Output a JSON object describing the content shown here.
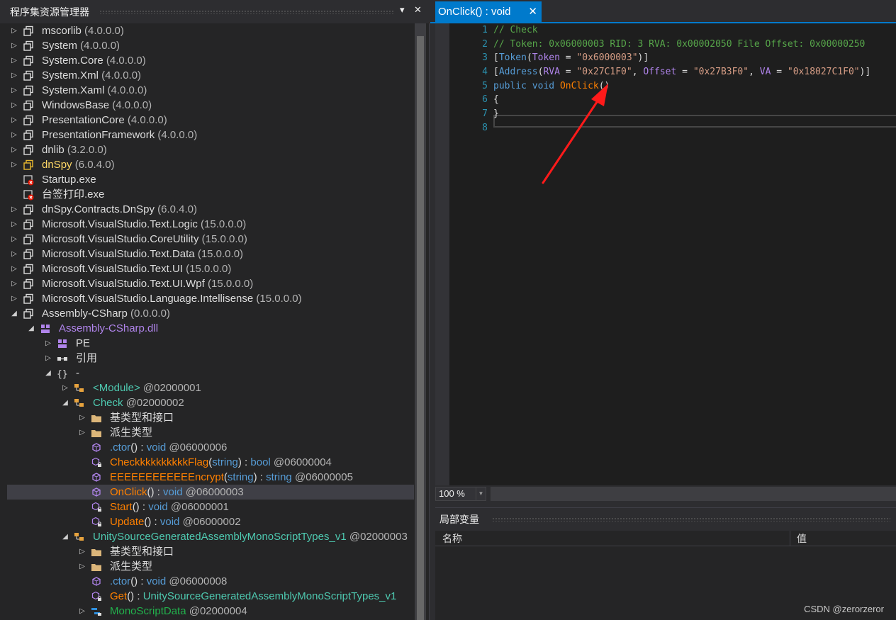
{
  "left_panel": {
    "title": "程序集资源管理器",
    "menu_glyph": "▾",
    "close_glyph": "✕",
    "tree": [
      {
        "indent": 0,
        "exp": "right",
        "icon": "assembly",
        "parts": [
          {
            "t": "mscorlib",
            "c": "white"
          },
          {
            "t": " (4.0.0.0)",
            "c": "gray"
          }
        ]
      },
      {
        "indent": 0,
        "exp": "right",
        "icon": "assembly",
        "parts": [
          {
            "t": "System",
            "c": "white"
          },
          {
            "t": " (4.0.0.0)",
            "c": "gray"
          }
        ]
      },
      {
        "indent": 0,
        "exp": "right",
        "icon": "assembly",
        "parts": [
          {
            "t": "System.Core",
            "c": "white"
          },
          {
            "t": " (4.0.0.0)",
            "c": "gray"
          }
        ]
      },
      {
        "indent": 0,
        "exp": "right",
        "icon": "assembly",
        "parts": [
          {
            "t": "System.Xml",
            "c": "white"
          },
          {
            "t": " (4.0.0.0)",
            "c": "gray"
          }
        ]
      },
      {
        "indent": 0,
        "exp": "right",
        "icon": "assembly",
        "parts": [
          {
            "t": "System.Xaml",
            "c": "white"
          },
          {
            "t": " (4.0.0.0)",
            "c": "gray"
          }
        ]
      },
      {
        "indent": 0,
        "exp": "right",
        "icon": "assembly",
        "parts": [
          {
            "t": "WindowsBase",
            "c": "white"
          },
          {
            "t": " (4.0.0.0)",
            "c": "gray"
          }
        ]
      },
      {
        "indent": 0,
        "exp": "right",
        "icon": "assembly",
        "parts": [
          {
            "t": "PresentationCore",
            "c": "white"
          },
          {
            "t": " (4.0.0.0)",
            "c": "gray"
          }
        ]
      },
      {
        "indent": 0,
        "exp": "right",
        "icon": "assembly",
        "parts": [
          {
            "t": "PresentationFramework",
            "c": "white"
          },
          {
            "t": " (4.0.0.0)",
            "c": "gray"
          }
        ]
      },
      {
        "indent": 0,
        "exp": "right",
        "icon": "assembly",
        "parts": [
          {
            "t": "dnlib",
            "c": "white"
          },
          {
            "t": " (3.2.0.0)",
            "c": "gray"
          }
        ]
      },
      {
        "indent": 0,
        "exp": "right",
        "icon": "assembly-yellow",
        "parts": [
          {
            "t": "dnSpy",
            "c": "yellow"
          },
          {
            "t": " (6.0.4.0)",
            "c": "gray"
          }
        ]
      },
      {
        "indent": 0,
        "exp": "none",
        "icon": "exe-error",
        "parts": [
          {
            "t": "Startup.exe",
            "c": "white"
          }
        ]
      },
      {
        "indent": 0,
        "exp": "none",
        "icon": "exe-error",
        "parts": [
          {
            "t": "台签打印.exe",
            "c": "white"
          }
        ]
      },
      {
        "indent": 0,
        "exp": "right",
        "icon": "assembly",
        "parts": [
          {
            "t": "dnSpy.Contracts.DnSpy",
            "c": "white"
          },
          {
            "t": " (6.0.4.0)",
            "c": "gray"
          }
        ]
      },
      {
        "indent": 0,
        "exp": "right",
        "icon": "assembly",
        "parts": [
          {
            "t": "Microsoft.VisualStudio.Text.Logic",
            "c": "white"
          },
          {
            "t": " (15.0.0.0)",
            "c": "gray"
          }
        ]
      },
      {
        "indent": 0,
        "exp": "right",
        "icon": "assembly",
        "parts": [
          {
            "t": "Microsoft.VisualStudio.CoreUtility",
            "c": "white"
          },
          {
            "t": " (15.0.0.0)",
            "c": "gray"
          }
        ]
      },
      {
        "indent": 0,
        "exp": "right",
        "icon": "assembly",
        "parts": [
          {
            "t": "Microsoft.VisualStudio.Text.Data",
            "c": "white"
          },
          {
            "t": " (15.0.0.0)",
            "c": "gray"
          }
        ]
      },
      {
        "indent": 0,
        "exp": "right",
        "icon": "assembly",
        "parts": [
          {
            "t": "Microsoft.VisualStudio.Text.UI",
            "c": "white"
          },
          {
            "t": " (15.0.0.0)",
            "c": "gray"
          }
        ]
      },
      {
        "indent": 0,
        "exp": "right",
        "icon": "assembly",
        "parts": [
          {
            "t": "Microsoft.VisualStudio.Text.UI.Wpf",
            "c": "white"
          },
          {
            "t": " (15.0.0.0)",
            "c": "gray"
          }
        ]
      },
      {
        "indent": 0,
        "exp": "right",
        "icon": "assembly",
        "parts": [
          {
            "t": "Microsoft.VisualStudio.Language.Intellisense",
            "c": "white"
          },
          {
            "t": " (15.0.0.0)",
            "c": "gray"
          }
        ]
      },
      {
        "indent": 0,
        "exp": "down",
        "icon": "assembly",
        "parts": [
          {
            "t": "Assembly-CSharp",
            "c": "white"
          },
          {
            "t": " (0.0.0.0)",
            "c": "gray"
          }
        ]
      },
      {
        "indent": 1,
        "exp": "down",
        "icon": "module",
        "parts": [
          {
            "t": "Assembly-CSharp.dll",
            "c": "asm"
          }
        ]
      },
      {
        "indent": 2,
        "exp": "right",
        "icon": "module",
        "parts": [
          {
            "t": "PE",
            "c": "white"
          }
        ]
      },
      {
        "indent": 2,
        "exp": "right",
        "icon": "reference",
        "parts": [
          {
            "t": "引用",
            "c": "white"
          }
        ]
      },
      {
        "indent": 2,
        "exp": "down",
        "icon": "namespace",
        "parts": [
          {
            "t": "-",
            "c": "white"
          }
        ]
      },
      {
        "indent": 3,
        "exp": "right",
        "icon": "class",
        "parts": [
          {
            "t": "<Module>",
            "c": "type"
          },
          {
            "t": " @02000001",
            "c": "gray"
          }
        ]
      },
      {
        "indent": 3,
        "exp": "down",
        "icon": "class",
        "parts": [
          {
            "t": "Check",
            "c": "type"
          },
          {
            "t": " @02000002",
            "c": "gray"
          }
        ]
      },
      {
        "indent": 4,
        "exp": "right",
        "icon": "folder",
        "parts": [
          {
            "t": "基类型和接口",
            "c": "white"
          }
        ]
      },
      {
        "indent": 4,
        "exp": "right",
        "icon": "folder",
        "parts": [
          {
            "t": "派生类型",
            "c": "white"
          }
        ]
      },
      {
        "indent": 4,
        "exp": "none",
        "icon": "method",
        "parts": [
          {
            "t": ".ctor",
            "c": "kw"
          },
          {
            "t": "() : ",
            "c": "white"
          },
          {
            "t": "void",
            "c": "kw"
          },
          {
            "t": " @06000006",
            "c": "gray"
          }
        ]
      },
      {
        "indent": 4,
        "exp": "none",
        "icon": "method-private",
        "parts": [
          {
            "t": "CheckkkkkkkkkkFlag",
            "c": "meth"
          },
          {
            "t": "(",
            "c": "white"
          },
          {
            "t": "string",
            "c": "kw"
          },
          {
            "t": ") : ",
            "c": "white"
          },
          {
            "t": "bool",
            "c": "kw"
          },
          {
            "t": " @06000004",
            "c": "gray"
          }
        ]
      },
      {
        "indent": 4,
        "exp": "none",
        "icon": "method",
        "parts": [
          {
            "t": "EEEEEEEEEEEEncrypt",
            "c": "meth"
          },
          {
            "t": "(",
            "c": "white"
          },
          {
            "t": "string",
            "c": "kw"
          },
          {
            "t": ") : ",
            "c": "white"
          },
          {
            "t": "string",
            "c": "kw"
          },
          {
            "t": " @06000005",
            "c": "gray"
          }
        ]
      },
      {
        "indent": 4,
        "exp": "none",
        "icon": "method",
        "sel": true,
        "parts": [
          {
            "t": "OnClick",
            "c": "meth"
          },
          {
            "t": "() : ",
            "c": "white"
          },
          {
            "t": "void",
            "c": "kw"
          },
          {
            "t": " @06000003",
            "c": "gray"
          }
        ]
      },
      {
        "indent": 4,
        "exp": "none",
        "icon": "method-private",
        "parts": [
          {
            "t": "Start",
            "c": "meth"
          },
          {
            "t": "() : ",
            "c": "white"
          },
          {
            "t": "void",
            "c": "kw"
          },
          {
            "t": " @06000001",
            "c": "gray"
          }
        ]
      },
      {
        "indent": 4,
        "exp": "none",
        "icon": "method-private",
        "parts": [
          {
            "t": "Update",
            "c": "meth"
          },
          {
            "t": "() : ",
            "c": "white"
          },
          {
            "t": "void",
            "c": "kw"
          },
          {
            "t": " @06000002",
            "c": "gray"
          }
        ]
      },
      {
        "indent": 3,
        "exp": "down",
        "icon": "class",
        "parts": [
          {
            "t": "UnitySourceGeneratedAssemblyMonoScriptTypes_v1",
            "c": "type"
          },
          {
            "t": " @02000003",
            "c": "gray"
          }
        ]
      },
      {
        "indent": 4,
        "exp": "right",
        "icon": "folder",
        "parts": [
          {
            "t": "基类型和接口",
            "c": "white"
          }
        ]
      },
      {
        "indent": 4,
        "exp": "right",
        "icon": "folder",
        "parts": [
          {
            "t": "派生类型",
            "c": "white"
          }
        ]
      },
      {
        "indent": 4,
        "exp": "none",
        "icon": "method",
        "parts": [
          {
            "t": ".ctor",
            "c": "kw"
          },
          {
            "t": "() : ",
            "c": "white"
          },
          {
            "t": "void",
            "c": "kw"
          },
          {
            "t": " @06000008",
            "c": "gray"
          }
        ]
      },
      {
        "indent": 4,
        "exp": "none",
        "icon": "method-private",
        "parts": [
          {
            "t": "Get",
            "c": "meth"
          },
          {
            "t": "() : ",
            "c": "white"
          },
          {
            "t": "UnitySourceGeneratedAssemblyMonoScriptTypes_v1",
            "c": "type"
          }
        ]
      },
      {
        "indent": 4,
        "exp": "right",
        "icon": "struct",
        "parts": [
          {
            "t": "MonoScriptData",
            "c": "data"
          },
          {
            "t": " @02000004",
            "c": "gray"
          }
        ]
      }
    ]
  },
  "editor": {
    "tab_label": "OnClick() : void",
    "tab_close": "✕",
    "line_numbers": [
      "1",
      "2",
      "3",
      "4",
      "5",
      "6",
      "7",
      "8"
    ],
    "lines": [
      [
        {
          "t": "// Check",
          "c": "com"
        }
      ],
      [
        {
          "t": "// Token: 0x06000003 RID: 3 RVA: 0x00002050 File Offset: 0x00000250",
          "c": "com"
        }
      ],
      [
        {
          "t": "[",
          "c": "plain"
        },
        {
          "t": "Token",
          "c": "type"
        },
        {
          "t": "(",
          "c": "plain"
        },
        {
          "t": "Token",
          "c": "prop"
        },
        {
          "t": " = ",
          "c": "plain"
        },
        {
          "t": "\"0x6000003\"",
          "c": "str"
        },
        {
          "t": ")]",
          "c": "plain"
        }
      ],
      [
        {
          "t": "[",
          "c": "plain"
        },
        {
          "t": "Address",
          "c": "type"
        },
        {
          "t": "(",
          "c": "plain"
        },
        {
          "t": "RVA",
          "c": "prop"
        },
        {
          "t": " = ",
          "c": "plain"
        },
        {
          "t": "\"0x27C1F0\"",
          "c": "str"
        },
        {
          "t": ", ",
          "c": "plain"
        },
        {
          "t": "Offset",
          "c": "prop"
        },
        {
          "t": " = ",
          "c": "plain"
        },
        {
          "t": "\"0x27B3F0\"",
          "c": "str"
        },
        {
          "t": ", ",
          "c": "plain"
        },
        {
          "t": "VA",
          "c": "prop"
        },
        {
          "t": " = ",
          "c": "plain"
        },
        {
          "t": "\"0x18027C1F0\"",
          "c": "str"
        },
        {
          "t": ")]",
          "c": "plain"
        }
      ],
      [
        {
          "t": "public",
          "c": "kw"
        },
        {
          "t": " ",
          "c": "plain"
        },
        {
          "t": "void",
          "c": "kw"
        },
        {
          "t": " ",
          "c": "plain"
        },
        {
          "t": "OnClick",
          "c": "meth"
        },
        {
          "t": "()",
          "c": "plain"
        }
      ],
      [
        {
          "t": "{",
          "c": "plain"
        }
      ],
      [
        {
          "t": "}",
          "c": "plain"
        }
      ],
      [
        {
          "t": "",
          "c": "plain"
        }
      ]
    ],
    "zoom": "100 %"
  },
  "locals": {
    "title": "局部变量",
    "col_name": "名称",
    "col_value": "值"
  },
  "watermark": "CSDN @zerorzeror"
}
